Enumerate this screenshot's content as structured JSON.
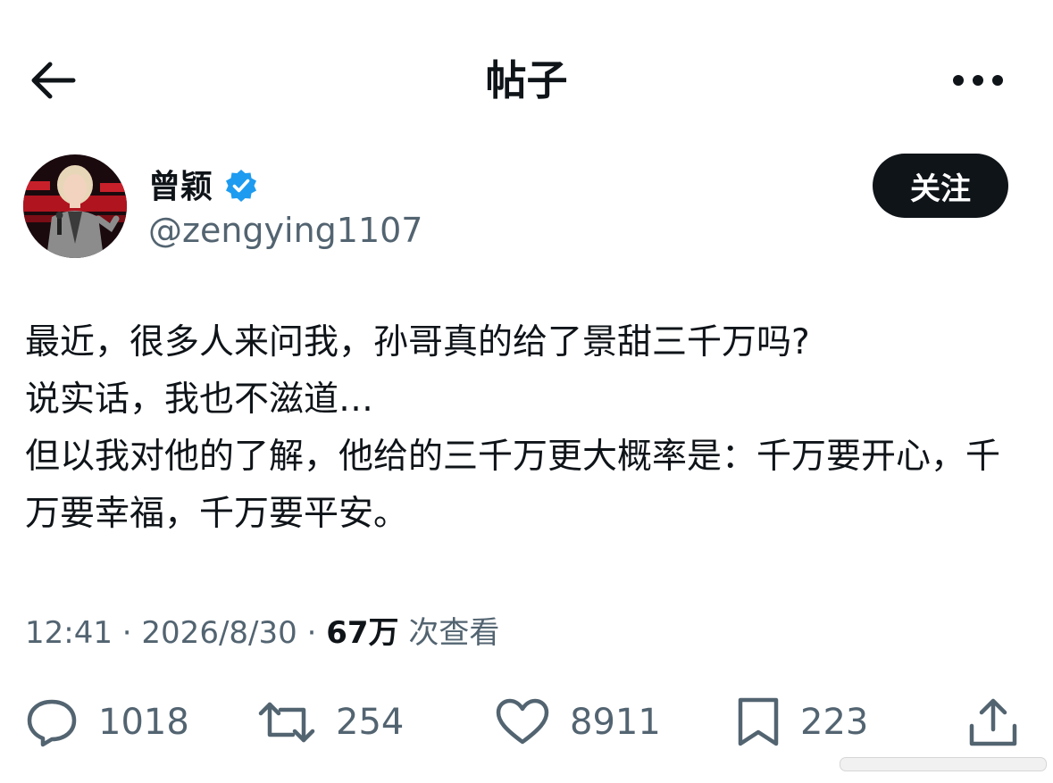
{
  "header": {
    "title": "帖子",
    "back_icon": "arrow-left-icon",
    "more_icon": "more-horizontal-icon"
  },
  "author": {
    "display_name": "曾颖",
    "handle": "@zengying1107",
    "verified": true,
    "follow_label": "关注"
  },
  "post": {
    "lines": [
      "最近，很多人来问我，孙哥真的给了景甜三千万吗?",
      "说实话，我也不滋道…",
      "但以我对他的了解，他给的三千万更大概率是：千万要开心，千万要幸福，千万要平安。"
    ]
  },
  "meta": {
    "time": "12:41",
    "date": "2026/8/30",
    "views_count": "67万",
    "views_label": "次查看"
  },
  "actions": {
    "replies": "1018",
    "reposts": "254",
    "likes": "8911",
    "bookmarks": "223"
  },
  "colors": {
    "text": "#0f1419",
    "secondary": "#536471",
    "verified_blue": "#1d9bf0",
    "button_bg": "#0f1419"
  }
}
